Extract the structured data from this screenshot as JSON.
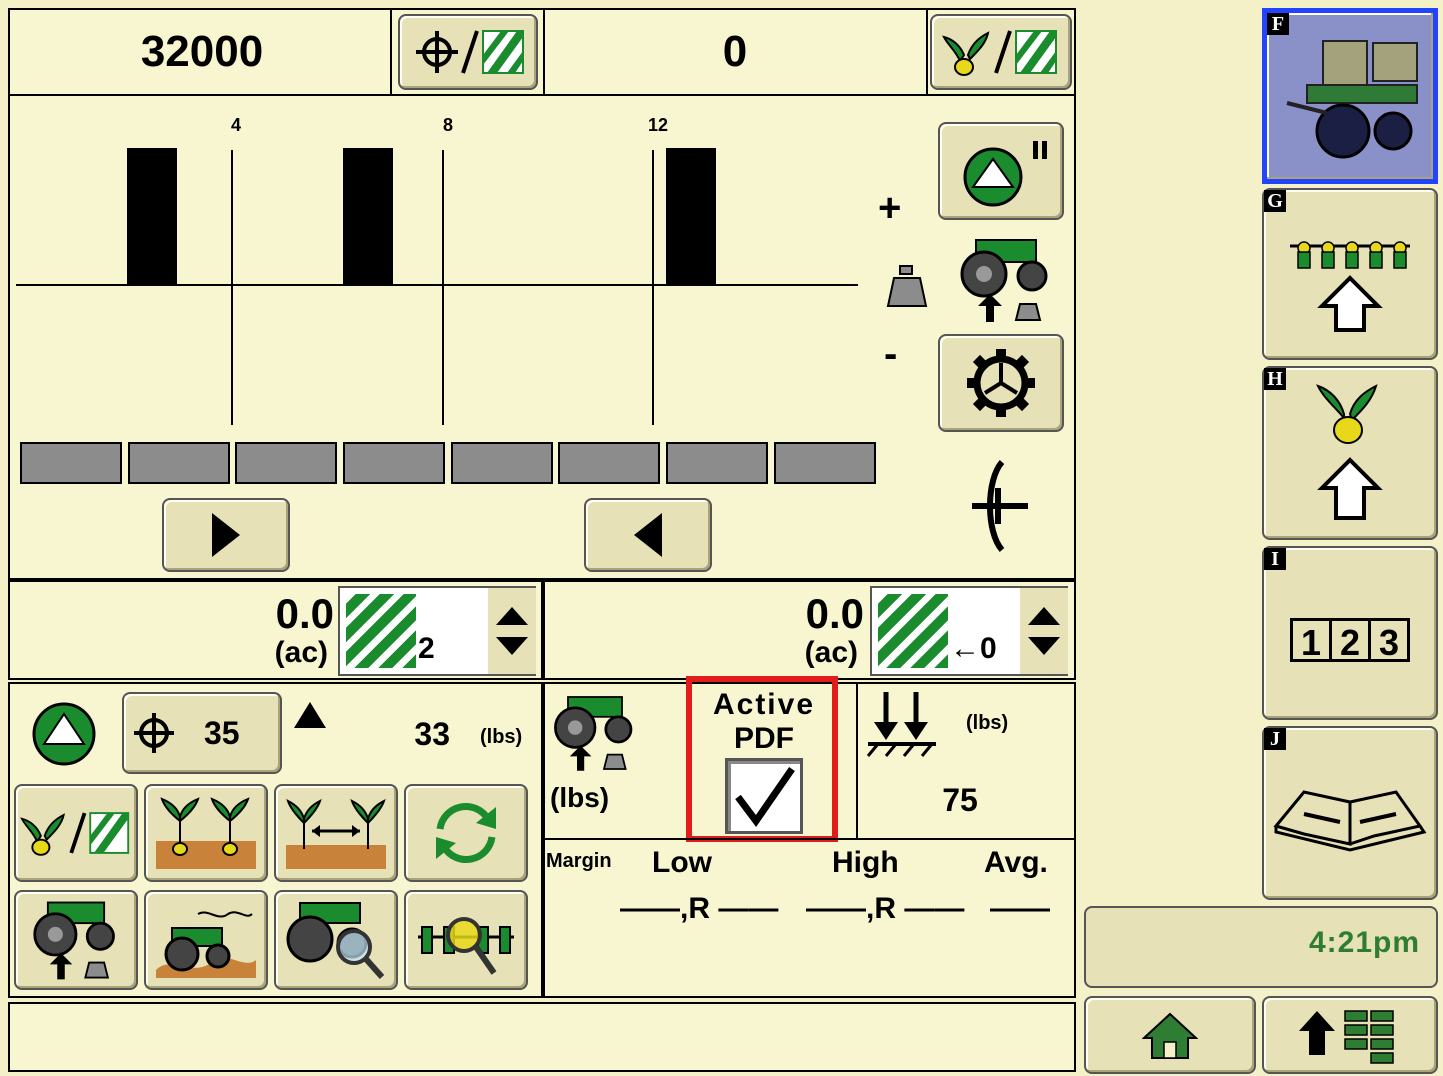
{
  "top": {
    "target_rate": "32000",
    "seed_count": "0"
  },
  "row_chart": {
    "ticks": [
      "4",
      "8",
      "12"
    ],
    "plus": "+",
    "minus": "-"
  },
  "area": {
    "left_value": "0.0",
    "left_unit": "(ac)",
    "left_counter": "2",
    "right_value": "0.0",
    "right_unit": "(ac)",
    "right_counter": "←0"
  },
  "downforce": {
    "target_value": "35",
    "actual_value": "33",
    "unit": "(lbs)"
  },
  "margin_panel": {
    "lbs_label": "(lbs)",
    "active_pdf_line1": "Active",
    "active_pdf_line2": "PDF",
    "active_pdf_checked": true,
    "gauge_unit": "(lbs)",
    "gauge_value": "75",
    "margin_label": "Margin",
    "col_low": "Low",
    "col_high": "High",
    "col_avg": "Avg.",
    "low_value": "——,R ——",
    "high_value": "——,R ——",
    "avg_value": "——"
  },
  "softkeys": {
    "f": "F",
    "g": "G",
    "h": "H",
    "i": "I",
    "i_digits": [
      "1",
      "2",
      "3"
    ],
    "j": "J"
  },
  "clock": "4:21pm",
  "colors": {
    "background": "#f4f1c8",
    "accent_green": "#1a8c2e",
    "yellow": "#e8d81a",
    "highlight_red": "#e21b1b",
    "selected_blue": "#2244ff"
  }
}
